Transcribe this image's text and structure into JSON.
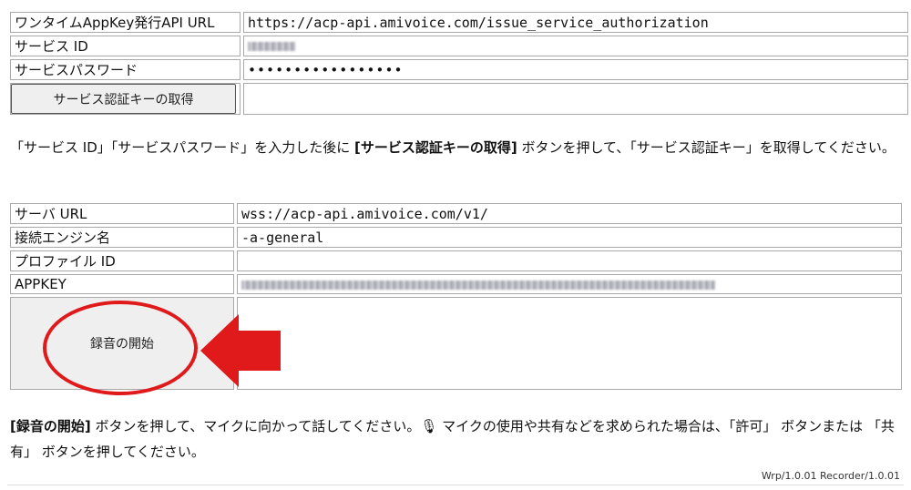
{
  "section1": {
    "rows": [
      {
        "label": "ワンタイムAppKey発行API URL",
        "value": "https://acp-api.amivoice.com/issue_service_authorization"
      },
      {
        "label": "サービス ID",
        "value": ""
      },
      {
        "label": "サービスパスワード",
        "value": "•••••••••••••••••"
      }
    ],
    "button_label": "サービス認証キーの取得",
    "button_result": ""
  },
  "instruction1": {
    "prefix": "「サービス ID」「サービスパスワード」を入力した後に ",
    "bold": "[サービス認証キーの取得]",
    "suffix": " ボタンを押して、「サービス認証キー」を取得してください。"
  },
  "section2": {
    "rows": [
      {
        "label": "サーバ URL",
        "value": "wss://acp-api.amivoice.com/v1/"
      },
      {
        "label": "接続エンジン名",
        "value": "-a-general"
      },
      {
        "label": "プロファイル ID",
        "value": ""
      },
      {
        "label": "APPKEY",
        "value": ""
      }
    ],
    "record_button_label": "録音の開始",
    "result_text": ""
  },
  "instruction2": {
    "bold": "[録音の開始]",
    "text1": " ボタンを押して、マイクに向かって話してください。",
    "mic_glyph": "🎙",
    "text2": " マイクの使用や共有などを求められた場合は、「許可」 ボタンまたは 「共有」 ボタンを押してください。"
  },
  "footer": "Wrp/1.0.01 Recorder/1.0.01",
  "colors": {
    "annotation": "#e0191b",
    "button_bg": "#efefef",
    "border": "#a9a9a9"
  },
  "icons": {
    "arrow": "left-arrow-icon",
    "highlight": "ellipse-highlight"
  }
}
